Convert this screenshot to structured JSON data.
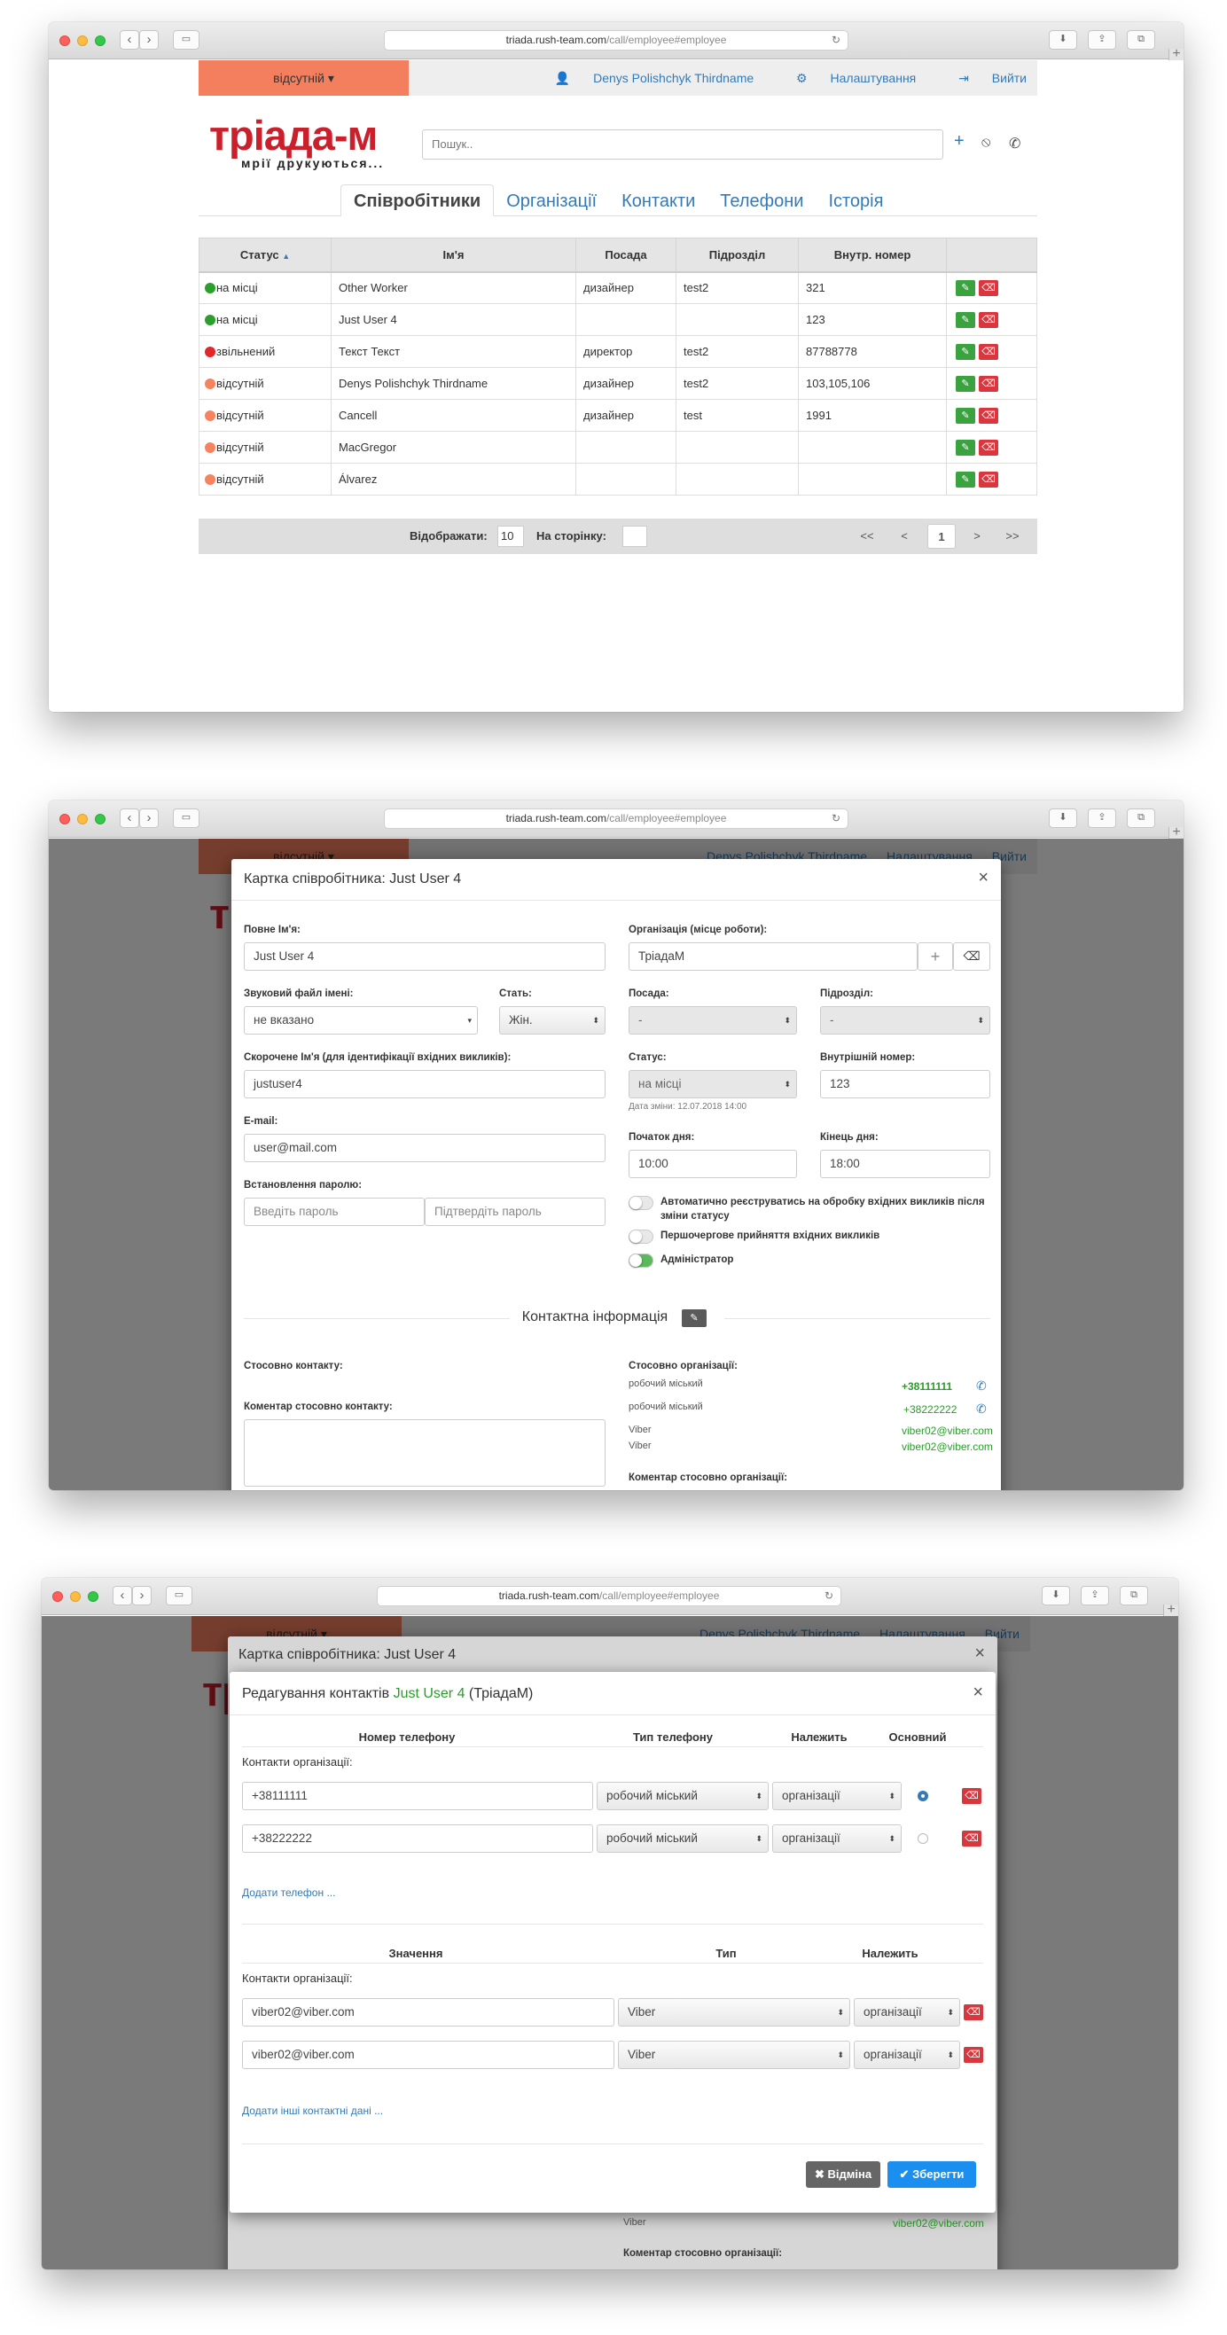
{
  "browser": {
    "url_host": "triada.rush-team.com",
    "url_path": "/call/employee#employee",
    "back": "‹",
    "forward": "›",
    "new_tab": "+"
  },
  "top": {
    "status": "відсутній",
    "user": "Denys Polishchyk Thirdname",
    "settings": "Налаштування",
    "logout": "Вийти"
  },
  "logo": {
    "name": "тріада-м",
    "tagline": "мрії друкуються..."
  },
  "search": {
    "placeholder": "Пошук.."
  },
  "tabs": [
    "Співробітники",
    "Організації",
    "Контакти",
    "Телефони",
    "Історія"
  ],
  "table": {
    "headers": [
      "Статус",
      "Ім'я",
      "Посада",
      "Підрозділ",
      "Внутр. номер"
    ],
    "rows": [
      {
        "status": "на місці",
        "state": "on",
        "name": "Other Worker",
        "position": "дизайнер",
        "dept": "test2",
        "ext": "321"
      },
      {
        "status": "на місці",
        "state": "on",
        "name": "Just User 4",
        "position": "",
        "dept": "",
        "ext": "123"
      },
      {
        "status": "звільнений",
        "state": "fired",
        "name": "Текст Текст",
        "position": "директор",
        "dept": "test2",
        "ext": "87788778"
      },
      {
        "status": "відсутній",
        "state": "off",
        "name": "Denys Polishchyk Thirdname",
        "position": "дизайнер",
        "dept": "test2",
        "ext": "103,105,106"
      },
      {
        "status": "відсутній",
        "state": "off",
        "name": "Cancell",
        "position": "дизайнер",
        "dept": "test",
        "ext": "1991"
      },
      {
        "status": "відсутній",
        "state": "off",
        "name": "MacGregor",
        "position": "",
        "dept": "",
        "ext": ""
      },
      {
        "status": "відсутній",
        "state": "off",
        "name": "Álvarez",
        "position": "",
        "dept": "",
        "ext": ""
      }
    ],
    "show_label": "Відображати:",
    "show_value": "10",
    "per_page_label": "На сторінку:",
    "page": "1",
    "first": "<<",
    "prev": "<",
    "next": ">",
    "last": ">>"
  },
  "card": {
    "title": "Картка співробітника: Just User 4",
    "close": "×",
    "full_name_label": "Повне Ім'я:",
    "full_name": "Just User 4",
    "org_label": "Організація (місце роботи):",
    "org": "ТріадаМ",
    "sound_label": "Звуковий файл імені:",
    "sound": "не вказано",
    "gender_label": "Стать:",
    "gender": "Жін.",
    "position_label": "Посада:",
    "position": "-",
    "dept_label": "Підрозділ:",
    "dept": "-",
    "short_label": "Скорочене Ім'я (для ідентифікації вхідних викликів):",
    "short": "justuser4",
    "status_label": "Статус:",
    "status": "на місці",
    "status_date": "Дата зміни: 12.07.2018 14:00",
    "ext_label": "Внутрішній номер:",
    "ext": "123",
    "email_label": "E-mail:",
    "email": "user@mail.com",
    "day_start_label": "Початок дня:",
    "day_start": "10:00",
    "day_end_label": "Кінець дня:",
    "day_end": "18:00",
    "pass_label": "Встановлення паролю:",
    "pass_ph": "Введіть пароль",
    "pass2_ph": "Підтвердіть пароль",
    "toggle1": "Автоматично реєструватись на обробку вхідних викликів після зміни статусу",
    "toggle2": "Першочергове прийняття вхідних викликів",
    "toggle3": "Адміністратор",
    "contact_info": "Контактна інформація",
    "contact_about": "Стосовно контакту:",
    "org_about": "Стосовно організації:",
    "comment_label": "Коментар стосовно контакту:",
    "org_comment_label": "Коментар стосовно організації:",
    "contacts": [
      {
        "type": "робочий міський",
        "value": "+38111111",
        "main": true
      },
      {
        "type": "робочий міський",
        "value": "+38222222",
        "main": false
      },
      {
        "type": "Viber",
        "value": "viber02@viber.com"
      },
      {
        "type": "Viber",
        "value": "viber02@viber.com"
      }
    ]
  },
  "edit": {
    "title_prefix": "Редагування контактів ",
    "title_name": "Just User 4",
    "title_suffix": " (ТріадаМ)",
    "close": "×",
    "phone_headers": [
      "Номер телефону",
      "Тип телефону",
      "Належить",
      "Основний"
    ],
    "org_contacts_label": "Контакти організації:",
    "phones": [
      {
        "number": "+38111111",
        "type": "робочий міський",
        "belongs": "організації",
        "main": true
      },
      {
        "number": "+38222222",
        "type": "робочий міський",
        "belongs": "організації",
        "main": false
      }
    ],
    "add_phone": "Додати телефон ...",
    "other_headers": [
      "Значення",
      "Тип",
      "Належить"
    ],
    "others": [
      {
        "value": "viber02@viber.com",
        "type": "Viber",
        "belongs": "організації"
      },
      {
        "value": "viber02@viber.com",
        "type": "Viber",
        "belongs": "організації"
      }
    ],
    "add_other": "Додати інші контактні дані ...",
    "cancel": "Відміна",
    "save": "Зберегти"
  },
  "colors": {
    "accent": "#337ab7",
    "status_away": "#f47f5f",
    "on": "#2aa02a",
    "fired": "#e3262b",
    "green_btn": "#3aa23e",
    "red_btn": "#d9363e"
  }
}
